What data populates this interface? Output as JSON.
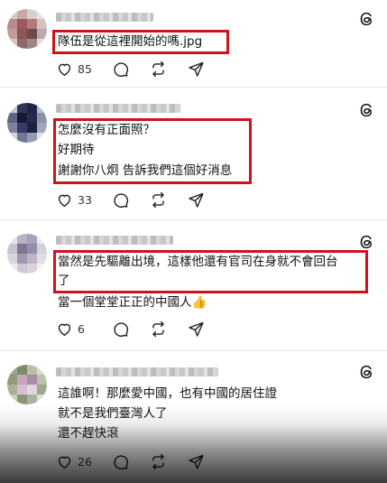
{
  "posts": [
    {
      "lines": [
        "隊伍是從這裡開始的嗎.jpg"
      ],
      "likes": "85"
    },
    {
      "lines": [
        "怎麼沒有正面照？",
        "好期待",
        "謝謝你八炯 告訴我們這個好消息"
      ],
      "likes": "33"
    },
    {
      "lines": [
        "當然是先驅離出境，這樣他還有官司在身就不會回台",
        "了",
        "當一個堂堂正正的中國人👍"
      ],
      "likes": "6"
    },
    {
      "lines": [
        "這誰啊！那麼愛中國，也有中國的居住證",
        "就不是我們臺灣人了",
        "還不趕快滾"
      ],
      "likes": "26"
    }
  ],
  "icons": {
    "like": "heart-icon",
    "reply": "comment-icon",
    "repost": "repost-icon",
    "share": "send-icon",
    "app": "threads-logo-icon"
  },
  "colors": {
    "highlight_border": "#d0121b"
  }
}
